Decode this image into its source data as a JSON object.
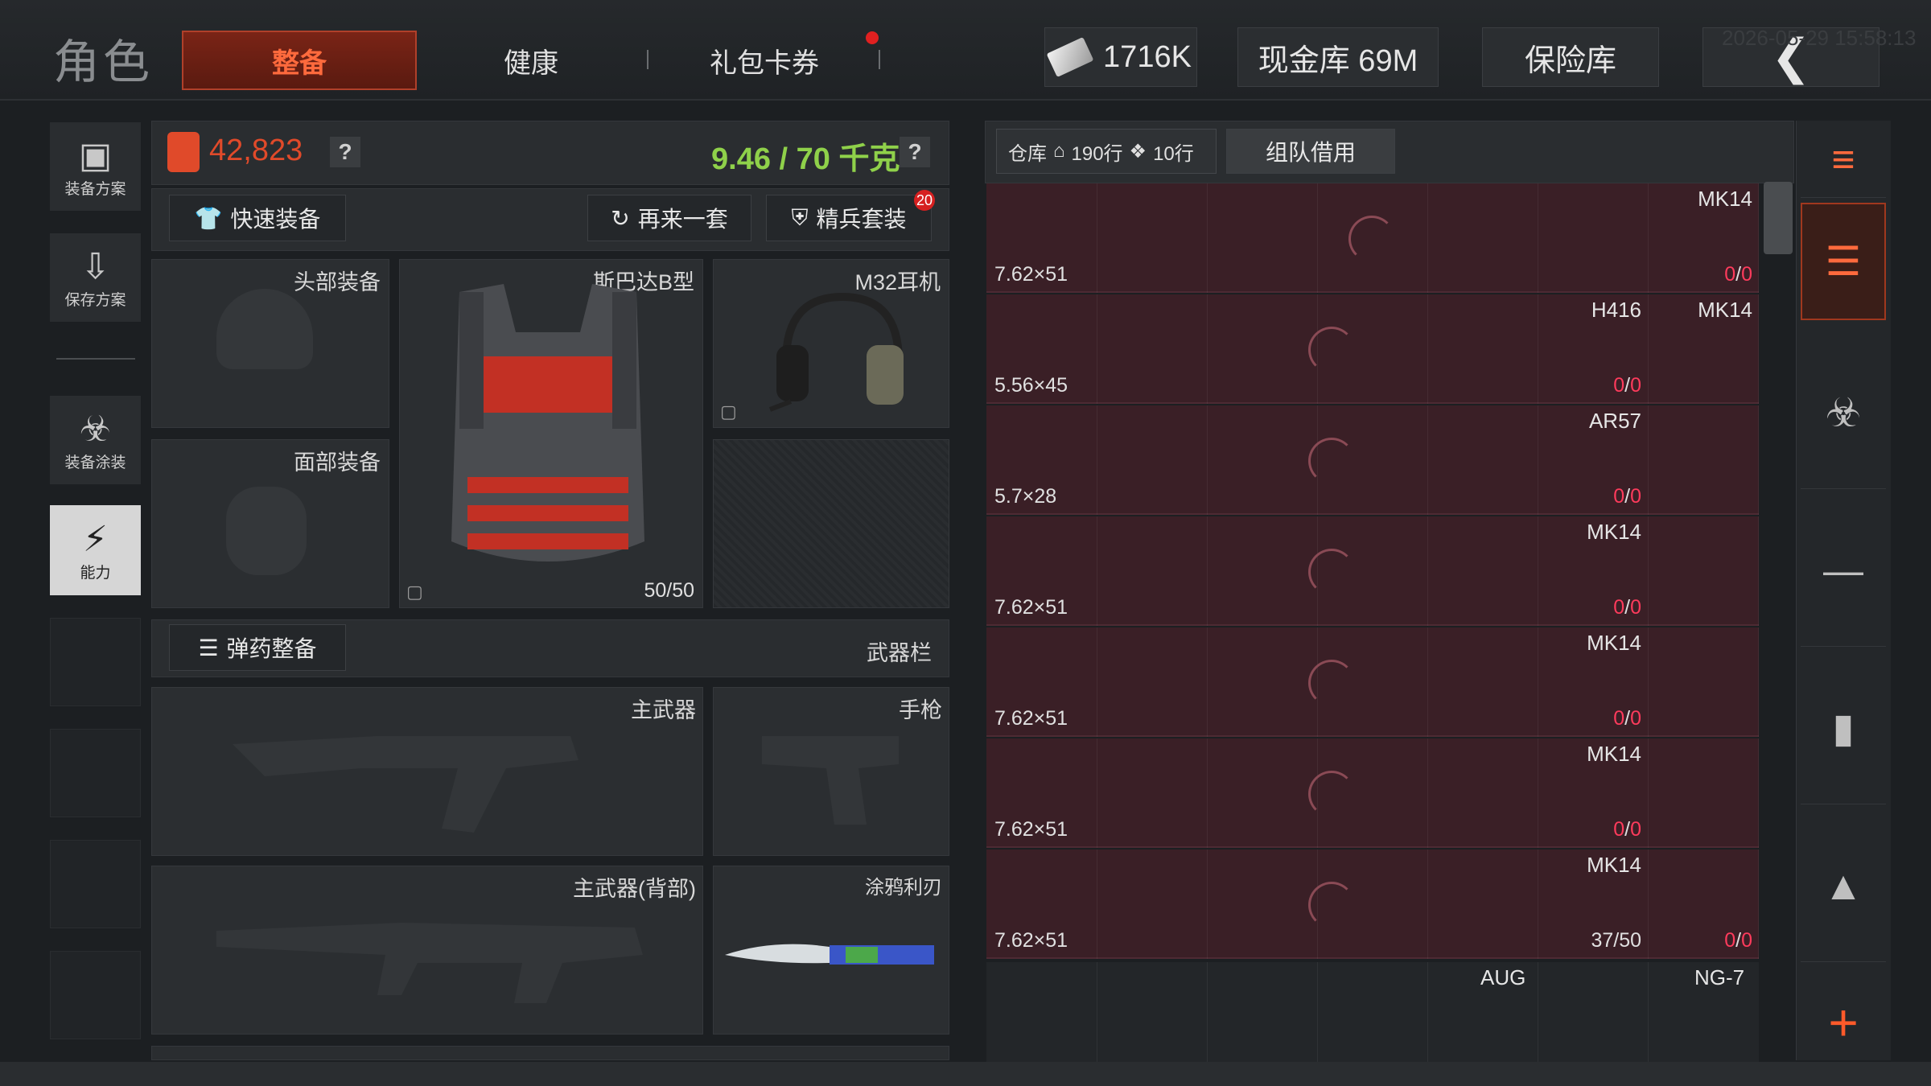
{
  "header": {
    "title": "角色",
    "tabs": [
      "整备",
      "健康",
      "礼包卡券"
    ],
    "active_tab": "整备",
    "currency": "1716K",
    "cash_vault": "现金库 69M",
    "safe_vault": "保险库",
    "back_icon": "chevron-left-icon",
    "timestamp": "2026-05-29 15:58:13"
  },
  "sidebar": {
    "items": [
      {
        "label": "装备方案",
        "icon": "vest-icon"
      },
      {
        "label": "保存方案",
        "icon": "download-icon"
      },
      {
        "label": "装备涂装",
        "icon": "helmet-paint-icon"
      },
      {
        "label": "能力",
        "icon": "lightning-shield-icon"
      }
    ]
  },
  "loadout": {
    "value": "42,823",
    "weight": "9.46 / 70 千克",
    "help": "?",
    "quick_equip": "快速装备",
    "reroll": "再来一套",
    "elite_set": "精兵套装",
    "elite_badge": "20",
    "slots": {
      "head": "头部装备",
      "face": "面部装备",
      "armor": "斯巴达B型",
      "armor_durability": "50/50",
      "headset": "M32耳机"
    },
    "ammo_button": "弹药整备",
    "weapon_bar": "武器栏",
    "weapons": {
      "primary": "主武器",
      "pistol": "手枪",
      "primary_back": "主武器(背部)",
      "melee": "涂鸦利刃"
    }
  },
  "warehouse": {
    "label": "仓库",
    "rows_home": "190行",
    "rows_tag": "10行",
    "team_borrow": "组队借用",
    "rows": [
      {
        "caliber": "7.62×51",
        "guns": [
          {
            "name": "MK14",
            "count_a": "0",
            "count_b": "0"
          }
        ]
      },
      {
        "caliber": "5.56×45",
        "guns": [
          {
            "name": "H416",
            "count_a": "0",
            "count_b": "0"
          },
          {
            "name": "MK14",
            "count_a": "",
            "count_b": ""
          }
        ]
      },
      {
        "caliber": "5.7×28",
        "guns": [
          {
            "name": "AR57",
            "count_a": "0",
            "count_b": "0"
          }
        ]
      },
      {
        "caliber": "7.62×51",
        "guns": [
          {
            "name": "MK14",
            "count_a": "0",
            "count_b": "0"
          }
        ]
      },
      {
        "caliber": "7.62×51",
        "guns": [
          {
            "name": "MK14",
            "count_a": "0",
            "count_b": "0"
          }
        ]
      },
      {
        "caliber": "7.62×51",
        "guns": [
          {
            "name": "MK14",
            "count_a": "0",
            "count_b": "0"
          }
        ]
      },
      {
        "caliber": "7.62×51",
        "guns": [
          {
            "name": "MK14",
            "count_a": "37/50",
            "count_b": ""
          },
          {
            "name": "",
            "count_a": "0",
            "count_b": "0"
          }
        ]
      }
    ],
    "bottom_row": [
      "AUG",
      "NG-7"
    ]
  },
  "colors": {
    "accent": "#ff6a3d",
    "value": "#e04a2a",
    "weight": "#8fd14a",
    "count_red": "#ff3b5c"
  }
}
